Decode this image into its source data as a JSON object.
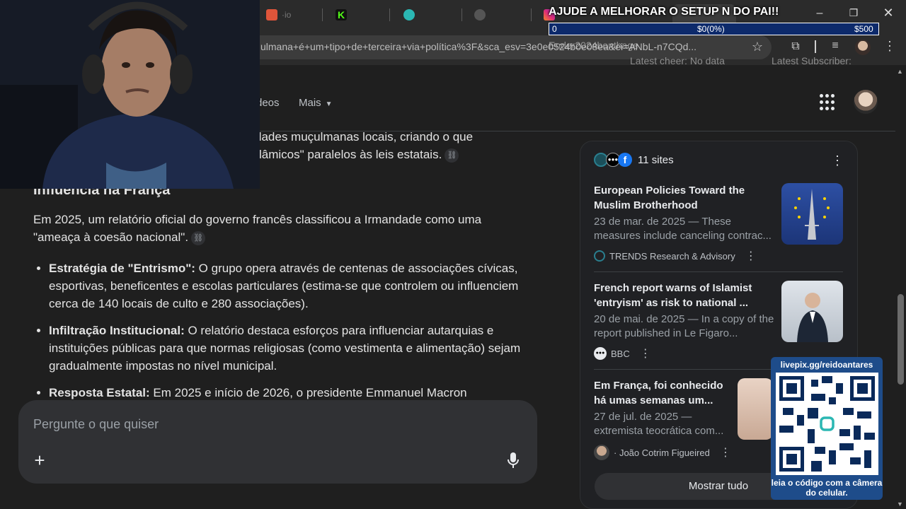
{
  "browser": {
    "tabs": [
      {
        "label": "",
        "color": "#e0553a"
      },
      {
        "label": "",
        "color": "#53fc18"
      },
      {
        "label": "",
        "color": "#2bb7b3"
      },
      {
        "label": "",
        "color": "#555555"
      },
      {
        "label": "",
        "color": "#c13584"
      }
    ],
    "url": "ulmana+é+um+tipo+de+terceira+via+política%3F&sca_esv=3e0e0524b0e08ea&ei=ANbL-n7CQd..."
  },
  "stream": {
    "banner_title": "AJUDE A MELHORAR O SETUP N DO PAI!!",
    "goal_current": "0",
    "goal_progress": "$0(0%)",
    "goal_target": "$500",
    "goal_fraction": 0,
    "overlay_text": "Ender2024bonthage",
    "latest_cheer": "Latest cheer: No data",
    "latest_subscriber": "Latest Subscriber:",
    "qr_url": "livepix.gg/reidoantares",
    "qr_caption": "leia o código com a câmera do celular."
  },
  "header": {
    "tab_videos": "deos",
    "tab_more": "Mais"
  },
  "article": {
    "top_line_1": "dades muçulmanas locais, criando o que",
    "top_line_2": "lâmicos\" paralelos às leis estatais.",
    "section_title": "Influência na França",
    "intro": "Em 2025, um relatório oficial do governo francês classificou a Irmandade como uma \"ameaça à coesão nacional\".",
    "bullets": [
      {
        "bold": "Estratégia de \"Entrismo\":",
        "text": " O grupo opera através de centenas de associações cívicas, esportivas, beneficentes e escolas particulares (estima-se que controlem ou influenciem cerca de 140 locais de culto e 280 associações)."
      },
      {
        "bold": "Infiltração Institucional:",
        "text": " O relatório destaca esforços para influenciar autarquias e instituições públicas para que normas religiosas (como vestimenta e alimentação) sejam gradualmente impostas no nível municipal."
      },
      {
        "bold": "Resposta Estatal:",
        "text": " Em 2025 e início de 2026, o presidente Emmanuel Macron"
      }
    ]
  },
  "ask": {
    "placeholder": "Pergunte o que quiser",
    "plus": "+"
  },
  "sources": {
    "count_label": "11 sites",
    "cards": [
      {
        "title": "European Policies Toward the Muslim Brotherhood",
        "meta": "23 de mar. de 2025 — These measures include canceling contrac...",
        "site": "TRENDS Research & Advisory"
      },
      {
        "title": "French report warns of Islamist 'entryism' as risk to national ...",
        "meta": "20 de mai. de 2025 — In a copy of the report published in Le Figaro...",
        "site": "BBC"
      },
      {
        "title": "Em França, foi conhecido há umas semanas um...",
        "meta": "27 de jul. de 2025 — extremista teocrática com...",
        "site": "· João Cotrim Figueired"
      }
    ],
    "show_all": "Mostrar tudo"
  }
}
